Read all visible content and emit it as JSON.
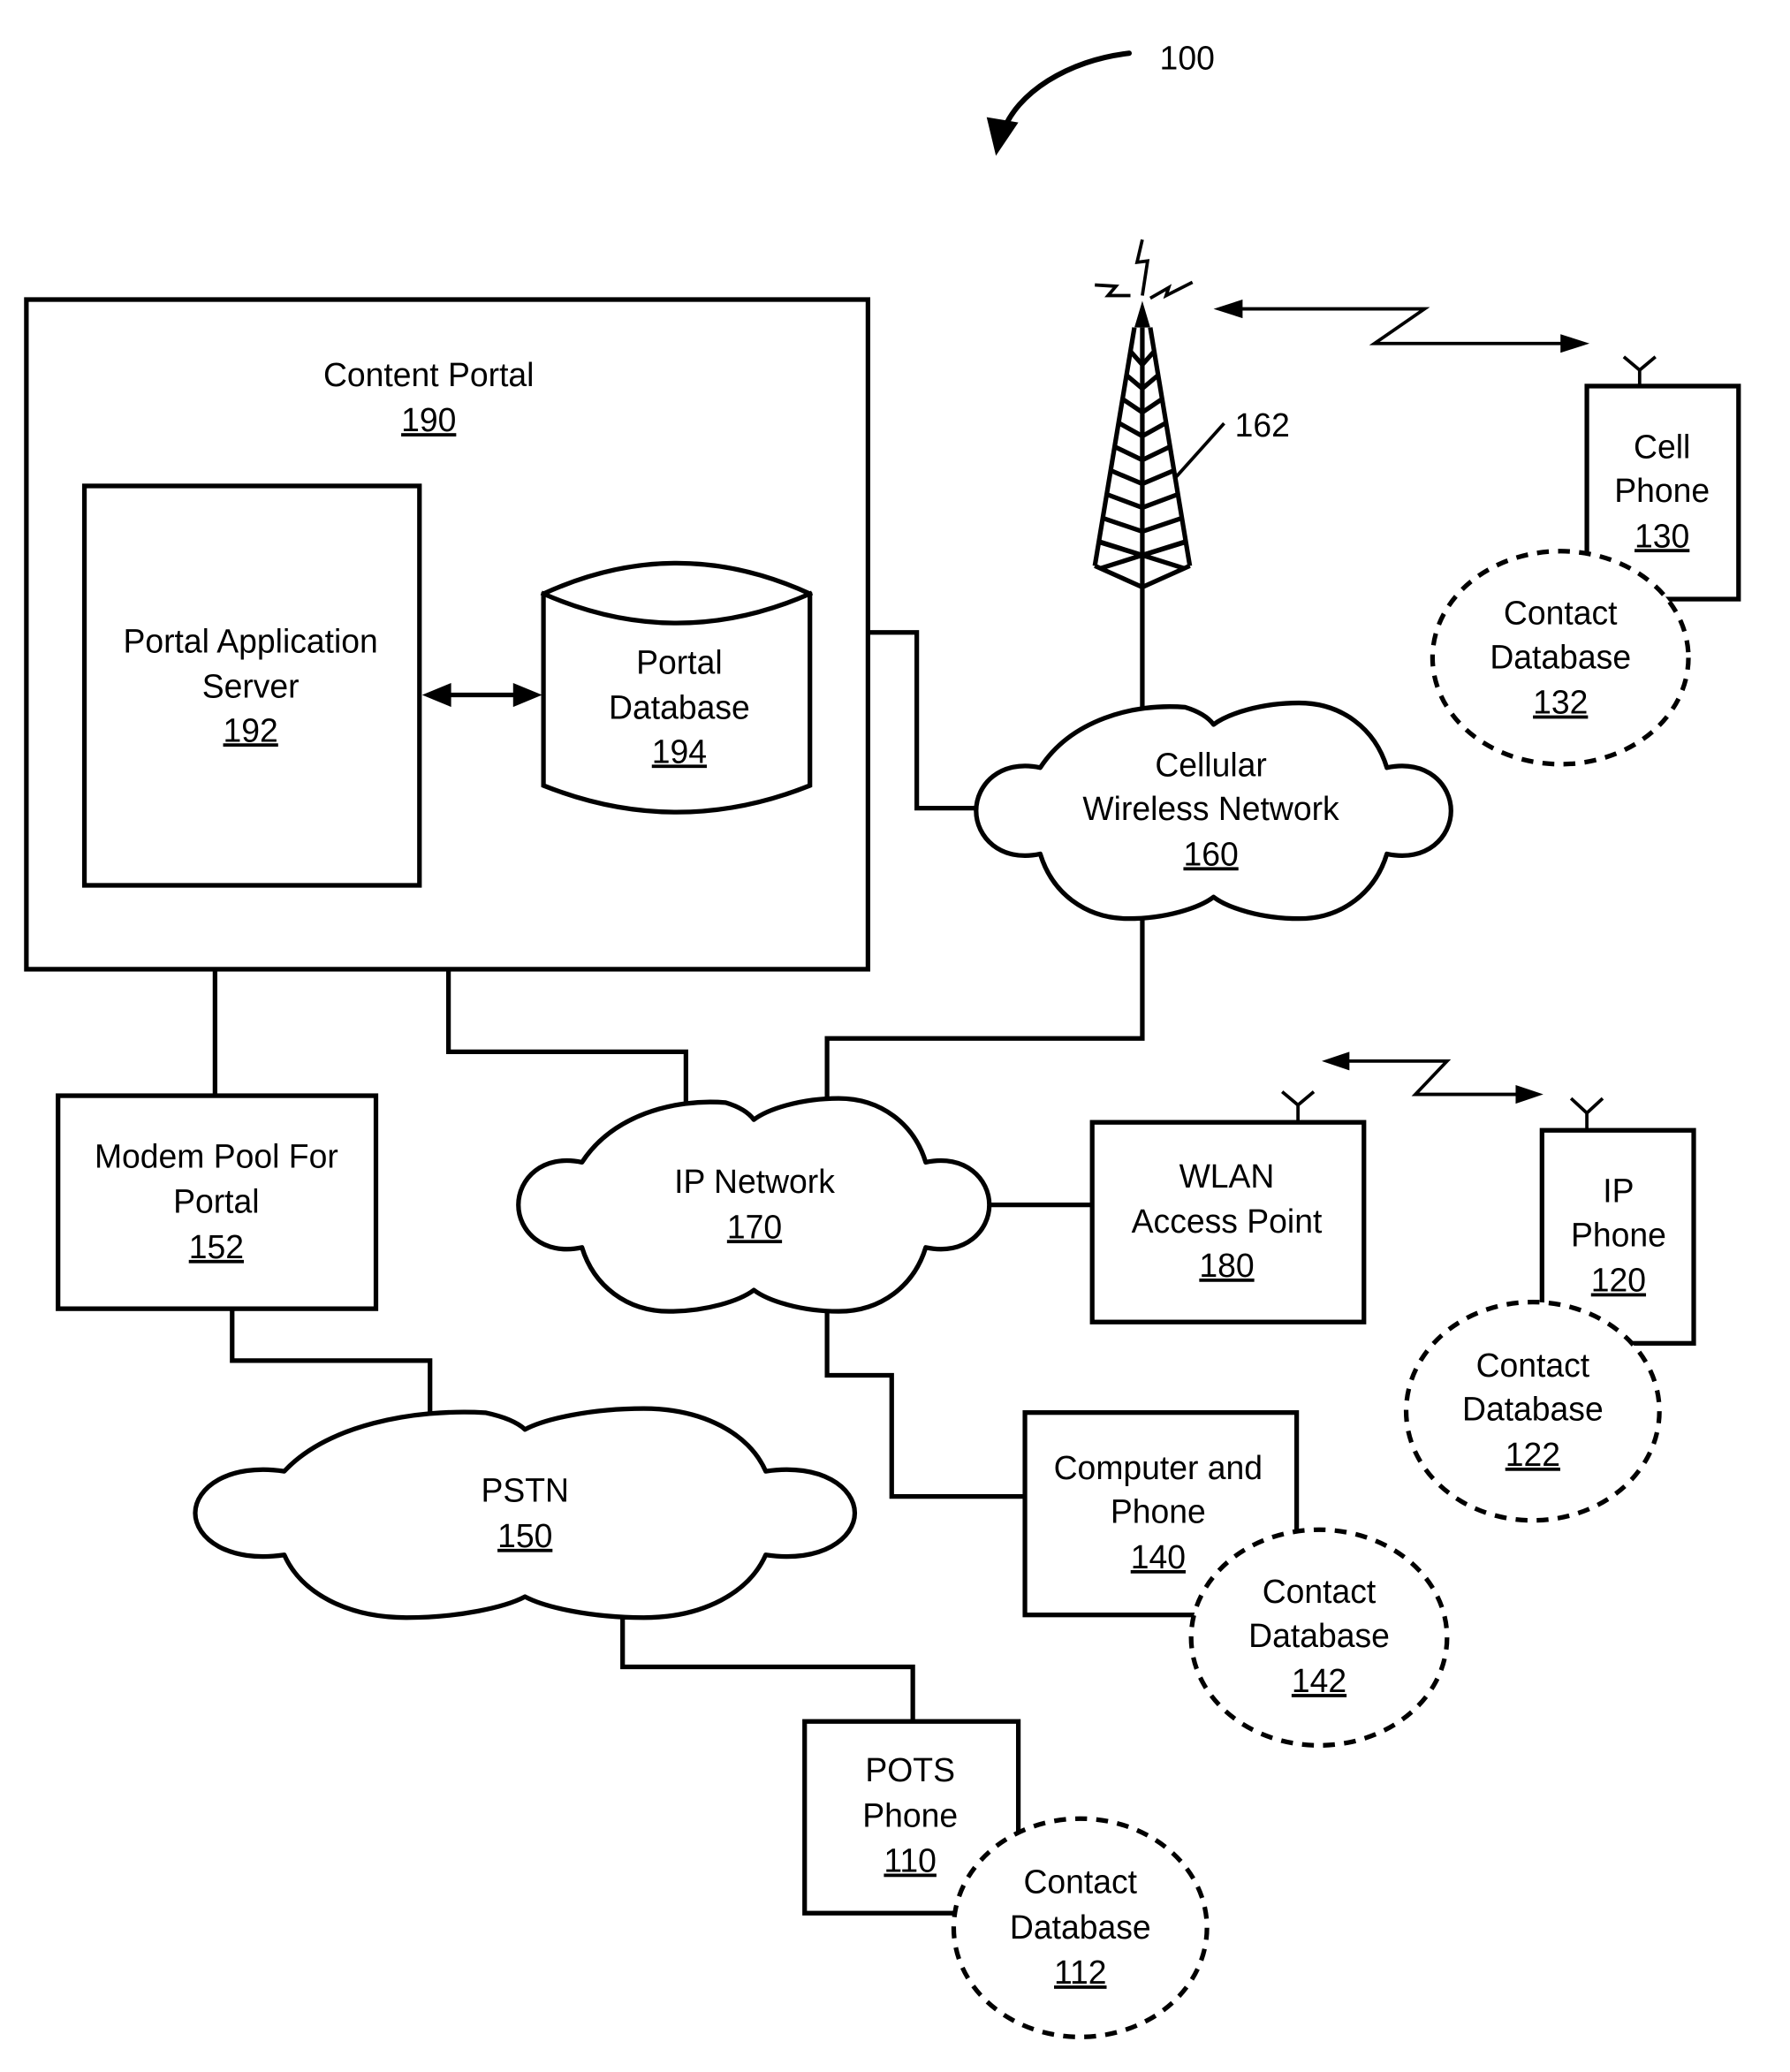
{
  "figure": {
    "ref": "100",
    "tower_ref": "162"
  },
  "nodes": {
    "content_portal": {
      "title": "Content Portal",
      "ref": "190"
    },
    "portal_app_server": {
      "lines": [
        "Portal Application",
        "Server"
      ],
      "ref": "192"
    },
    "portal_database": {
      "lines": [
        "Portal",
        "Database"
      ],
      "ref": "194"
    },
    "cellular_network": {
      "lines": [
        "Cellular",
        "Wireless Network"
      ],
      "ref": "160"
    },
    "cell_phone": {
      "lines": [
        "Cell",
        "Phone"
      ],
      "ref": "130"
    },
    "contact_db_132": {
      "lines": [
        "Contact",
        "Database"
      ],
      "ref": "132"
    },
    "modem_pool": {
      "lines": [
        "Modem Pool For",
        "Portal"
      ],
      "ref": "152"
    },
    "ip_network": {
      "lines": [
        "IP Network"
      ],
      "ref": "170"
    },
    "wlan_ap": {
      "lines": [
        "WLAN",
        "Access Point"
      ],
      "ref": "180"
    },
    "ip_phone": {
      "lines": [
        "IP",
        "Phone"
      ],
      "ref": "120"
    },
    "contact_db_122": {
      "lines": [
        "Contact",
        "Database"
      ],
      "ref": "122"
    },
    "computer_phone": {
      "lines": [
        "Computer and",
        "Phone"
      ],
      "ref": "140"
    },
    "contact_db_142": {
      "lines": [
        "Contact",
        "Database"
      ],
      "ref": "142"
    },
    "pstn": {
      "lines": [
        "PSTN"
      ],
      "ref": "150"
    },
    "pots_phone": {
      "lines": [
        "POTS",
        "Phone"
      ],
      "ref": "110"
    },
    "contact_db_112": {
      "lines": [
        "Contact",
        "Database"
      ],
      "ref": "112"
    }
  }
}
